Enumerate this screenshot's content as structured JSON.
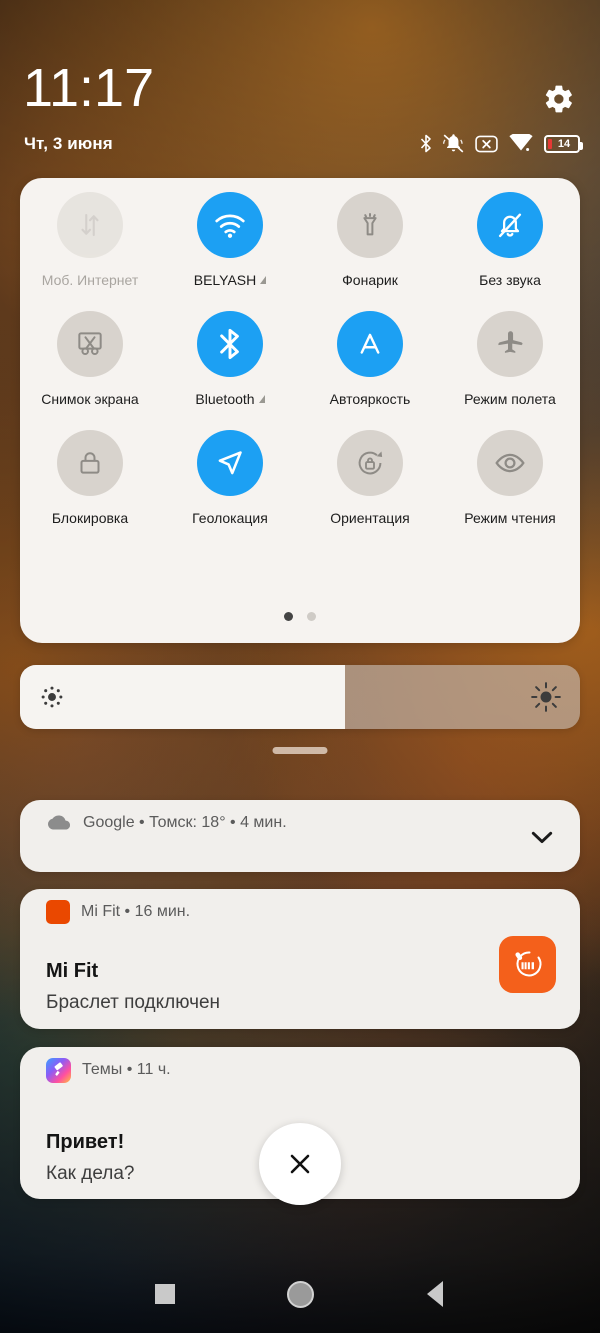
{
  "statusbar": {
    "time": "11:17",
    "date": "Чт, 3 июня",
    "battery_percent": "14",
    "icons": [
      "bluetooth-icon",
      "vibrate-off-icon",
      "no-sim-icon",
      "wifi-icon",
      "battery-icon"
    ],
    "settings_icon": "gear-icon"
  },
  "quick_settings": {
    "tiles": [
      {
        "label": "Моб. Интернет",
        "icon": "mobile-data-icon",
        "state": "disabled",
        "caret": false
      },
      {
        "label": "BELYASH",
        "icon": "wifi-icon",
        "state": "on",
        "caret": true
      },
      {
        "label": "Фонарик",
        "icon": "flashlight-icon",
        "state": "off",
        "caret": false
      },
      {
        "label": "Без звука",
        "icon": "bell-off-icon",
        "state": "on",
        "caret": false
      },
      {
        "label": "Снимок экрана",
        "icon": "screenshot-icon",
        "state": "off",
        "caret": false
      },
      {
        "label": "Bluetooth",
        "icon": "bluetooth-icon",
        "state": "on",
        "caret": true
      },
      {
        "label": "Автояркость",
        "icon": "auto-brightness-icon",
        "state": "on",
        "caret": false
      },
      {
        "label": "Режим полета",
        "icon": "airplane-icon",
        "state": "off",
        "caret": false
      },
      {
        "label": "Блокировка",
        "icon": "lock-icon",
        "state": "off",
        "caret": false
      },
      {
        "label": "Геолокация",
        "icon": "location-arrow-icon",
        "state": "on",
        "caret": false
      },
      {
        "label": "Ориентация",
        "icon": "rotation-lock-icon",
        "state": "off",
        "caret": false
      },
      {
        "label": "Режим чтения",
        "icon": "eye-icon",
        "state": "off",
        "caret": false
      }
    ],
    "page_count": 2,
    "active_page": 1,
    "accent_color": "#1ca0f3",
    "panel_color": "#f6f3f0"
  },
  "brightness": {
    "level_percent": 58,
    "low_icon": "brightness-low-icon",
    "high_icon": "brightness-high-icon"
  },
  "notifications": [
    {
      "app": "Google",
      "header": "Google • Томск: 18° • 4 мин.",
      "icon": "cloud-icon",
      "expand_icon": "chevron-down-icon"
    },
    {
      "app": "Mi Fit",
      "header": "Mi Fit • 16 мин.",
      "title": "Mi Fit",
      "body": "Браслет подключен",
      "icon": "mifit-icon",
      "icon_color": "#f4601b"
    },
    {
      "app": "Темы",
      "header": "Темы • 11 ч.",
      "title": "Привет!",
      "body": "Как дела?",
      "icon": "themes-icon"
    }
  ],
  "clear_all": {
    "icon": "close-icon",
    "label": ""
  },
  "navbar": {
    "recents": "recents-square-icon",
    "home": "home-circle-icon",
    "back": "back-triangle-icon"
  }
}
